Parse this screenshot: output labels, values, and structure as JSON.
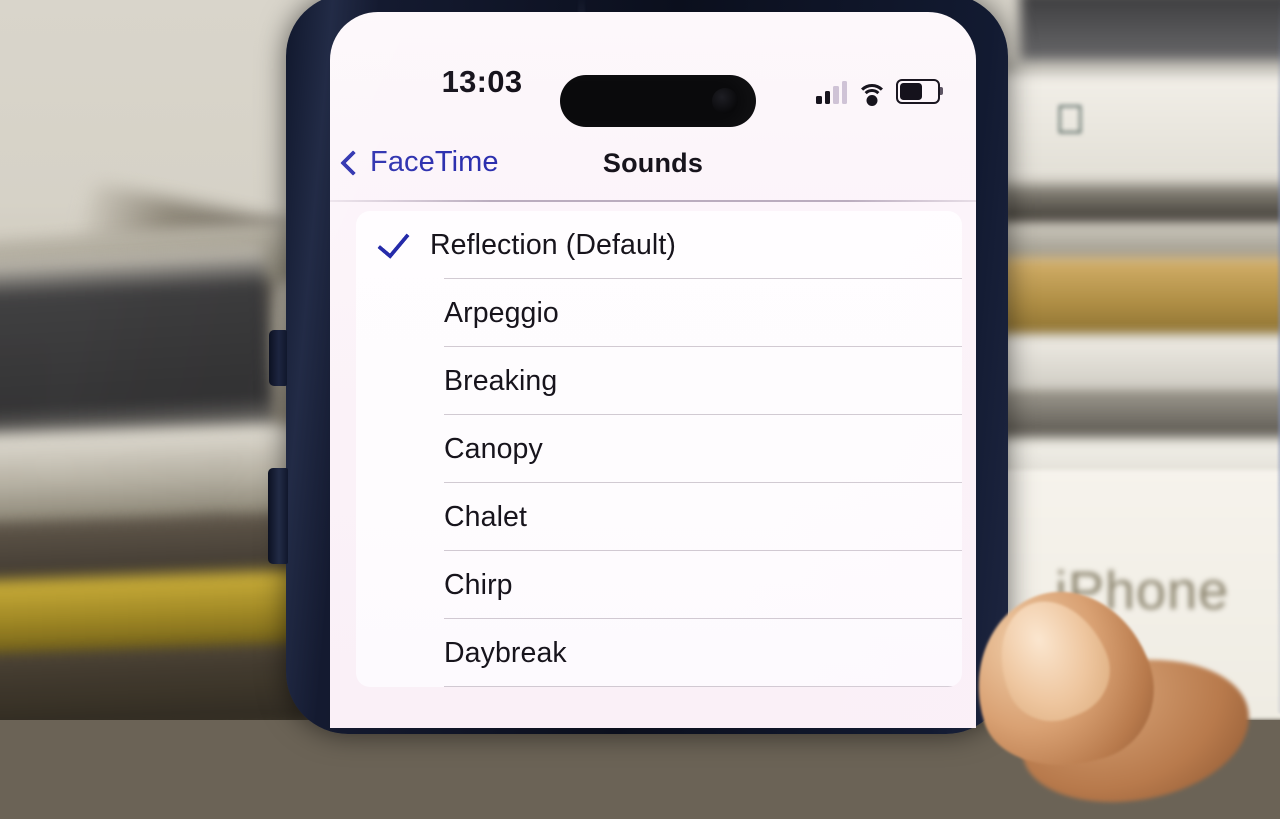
{
  "device": {
    "status_bar": {
      "time": "13:03",
      "cellular_icon": "cellular-signal-icon",
      "cellular_bars_filled": 2,
      "cellular_bars_total": 4,
      "wifi_icon": "wifi-icon",
      "battery_icon": "battery-icon",
      "battery_level_percent": 56
    }
  },
  "nav": {
    "back_label": "FaceTime",
    "back_icon": "chevron-left-icon",
    "title": "Sounds"
  },
  "colors": {
    "accent_blue": "#2b2fae",
    "checkmark_blue": "#2126a8",
    "screen_background": "#fbf2f8",
    "card_background": "#fffdff",
    "text_primary": "#17141c"
  },
  "sounds": {
    "selected": "Reflection (Default)",
    "items": [
      {
        "label": "Reflection (Default)",
        "selected": true
      },
      {
        "label": "Arpeggio",
        "selected": false
      },
      {
        "label": "Breaking",
        "selected": false
      },
      {
        "label": "Canopy",
        "selected": false
      },
      {
        "label": "Chalet",
        "selected": false
      },
      {
        "label": "Chirp",
        "selected": false
      },
      {
        "label": "Daybreak",
        "selected": false
      }
    ]
  },
  "background_scene": {
    "box_text": "iPhone"
  }
}
